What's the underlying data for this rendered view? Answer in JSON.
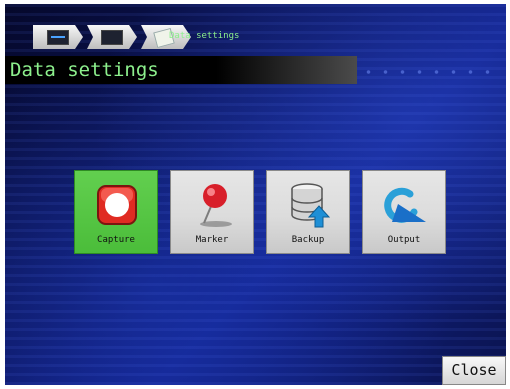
{
  "breadcrumb": {
    "title": "Data settings",
    "items": [
      {
        "icon": "monitor-icon"
      },
      {
        "icon": "display-icon"
      },
      {
        "icon": "document-icon"
      }
    ]
  },
  "page": {
    "title": "Data settings"
  },
  "tiles": [
    {
      "label": "Capture",
      "icon": "record-icon",
      "selected": true,
      "color": "#4bbd3a"
    },
    {
      "label": "Marker",
      "icon": "pin-icon",
      "selected": false
    },
    {
      "label": "Backup",
      "icon": "database-upload-icon",
      "selected": false
    },
    {
      "label": "Output",
      "icon": "output-arrow-icon",
      "selected": false
    }
  ],
  "footer": {
    "close_label": "Close"
  }
}
